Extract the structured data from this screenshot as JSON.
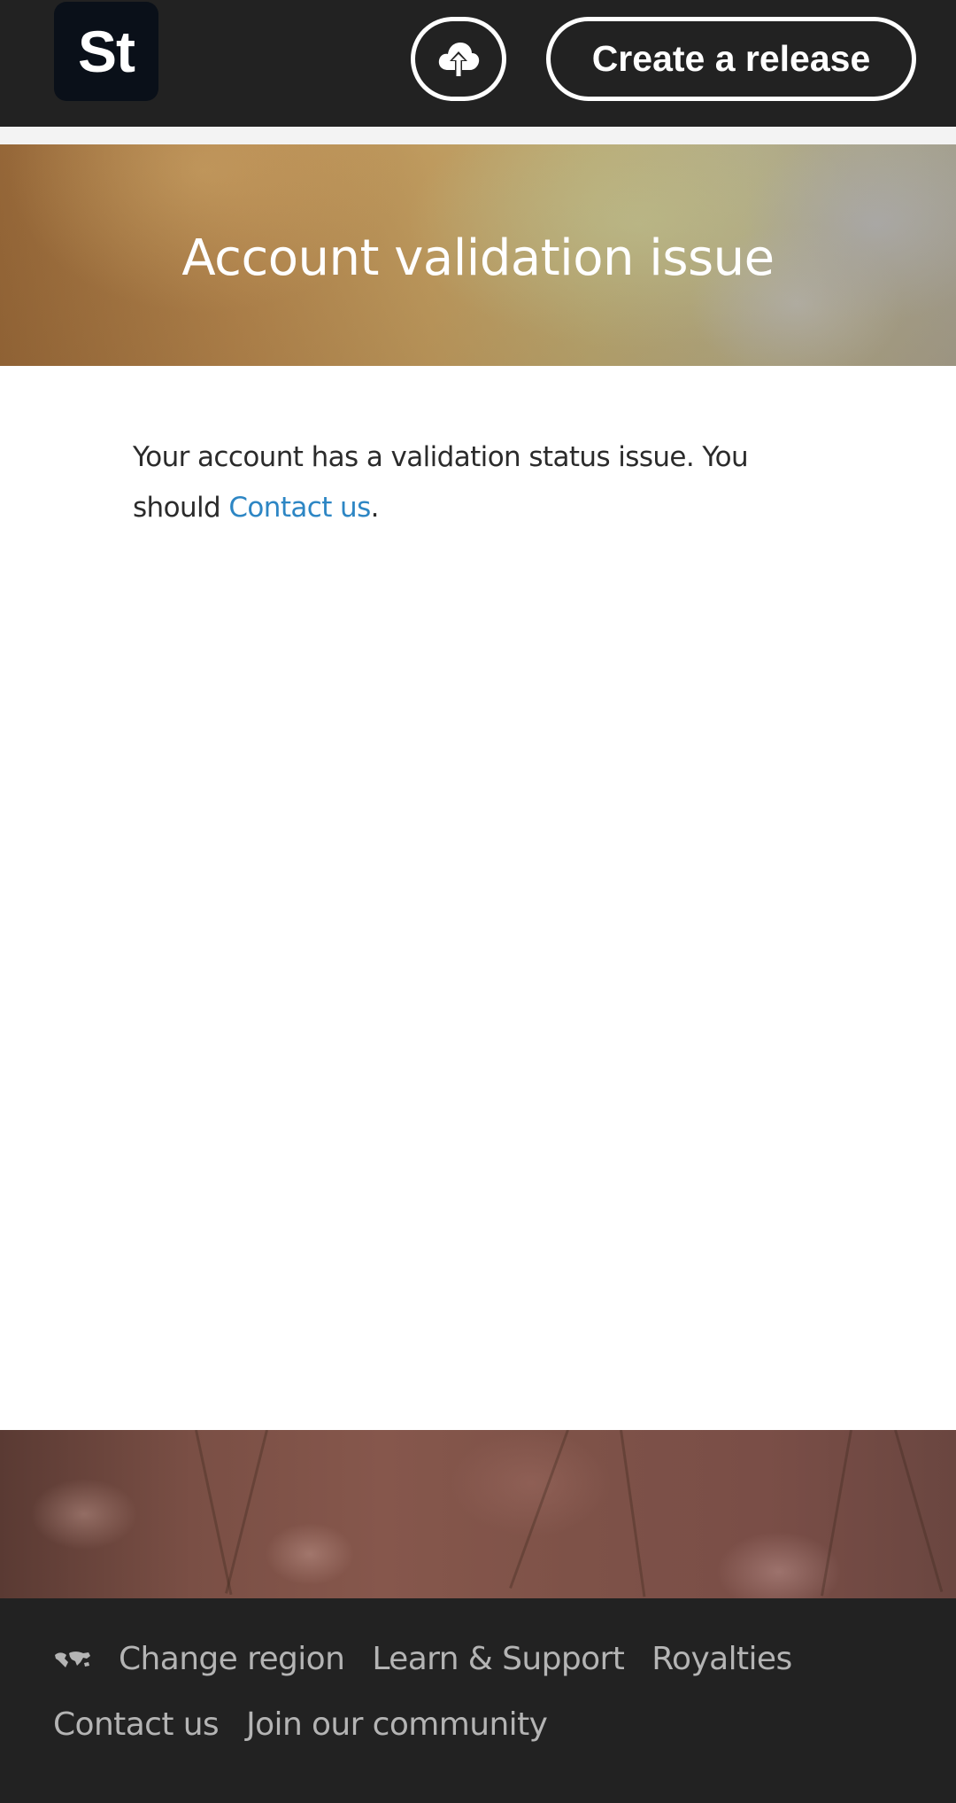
{
  "header": {
    "logo_text": "St",
    "upload_icon": "cloud-upload-icon",
    "create_release_label": "Create a release"
  },
  "hero": {
    "title": "Account validation issue"
  },
  "content": {
    "message": "Your account has a validation status issue. You should ",
    "link_label": "Contact us",
    "message_end": "."
  },
  "footer": {
    "globe_icon": "globe-icon",
    "links": [
      "Change region",
      "Learn & Support",
      "Royalties",
      "Contact us",
      "Join our community"
    ]
  },
  "colors": {
    "header_bg": "#222222",
    "logo_bg": "#0a1019",
    "link": "#2d86c4",
    "footer_text": "#b4b4b4"
  }
}
